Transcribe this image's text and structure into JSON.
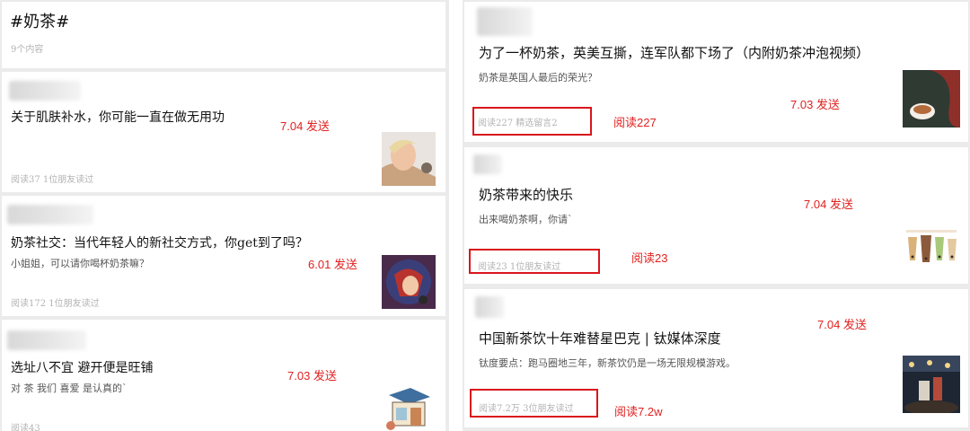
{
  "topic": {
    "title": "#奶茶#",
    "count": "9个内容"
  },
  "left_articles": [
    {
      "title": "关于肌肤补水，你可能一直在做无用功",
      "desc": "",
      "meta": "阅读37  1位朋友读过",
      "note": "7.04 发送",
      "thumb": "skincare-photo"
    },
    {
      "title": "奶茶社交：当代年轻人的新社交方式，你get到了吗？",
      "desc": "小姐姐，可以请你喝杯奶茶嘛？",
      "meta": "阅读172  1位朋友读过",
      "note": "6.01 发送",
      "thumb": "milk-tea-photo"
    },
    {
      "title": "选址八不宜 避开便是旺铺",
      "desc": "对 茶 我们 喜爱 是认真的`",
      "meta": "阅读43",
      "note": "7.03 发送",
      "thumb": "shop-illustration"
    }
  ],
  "right_articles": [
    {
      "title": "为了一杯奶茶，英美互撕，连军队都下场了（内附奶茶冲泡视频）",
      "desc": "奶茶是英国人最后的荣光？",
      "meta": "阅读227  精选留言2",
      "note": "7.03 发送",
      "highlight": "阅读227",
      "thumb": "tea-cup-photo"
    },
    {
      "title": "奶茶带来的快乐",
      "desc": "出来喝奶茶啊，你请`",
      "meta": "阅读23  1位朋友读过",
      "note": "7.04 发送",
      "highlight": "阅读23",
      "thumb": "bubble-tea-illustration"
    },
    {
      "title": "中国新茶饮十年难替星巴克 | 钛媒体深度",
      "desc": "钛度要点：跑马圈地三年，新茶饮仍是一场无限规模游戏。",
      "meta": "阅读7.2万  3位朋友读过",
      "note": "7.04 发送",
      "highlight": "阅读7.2w",
      "thumb": "tea-street-photo"
    }
  ],
  "colors": {
    "annotation": "#e0201f",
    "highlight_box": "#d9161c",
    "background": "#ebebeb"
  }
}
